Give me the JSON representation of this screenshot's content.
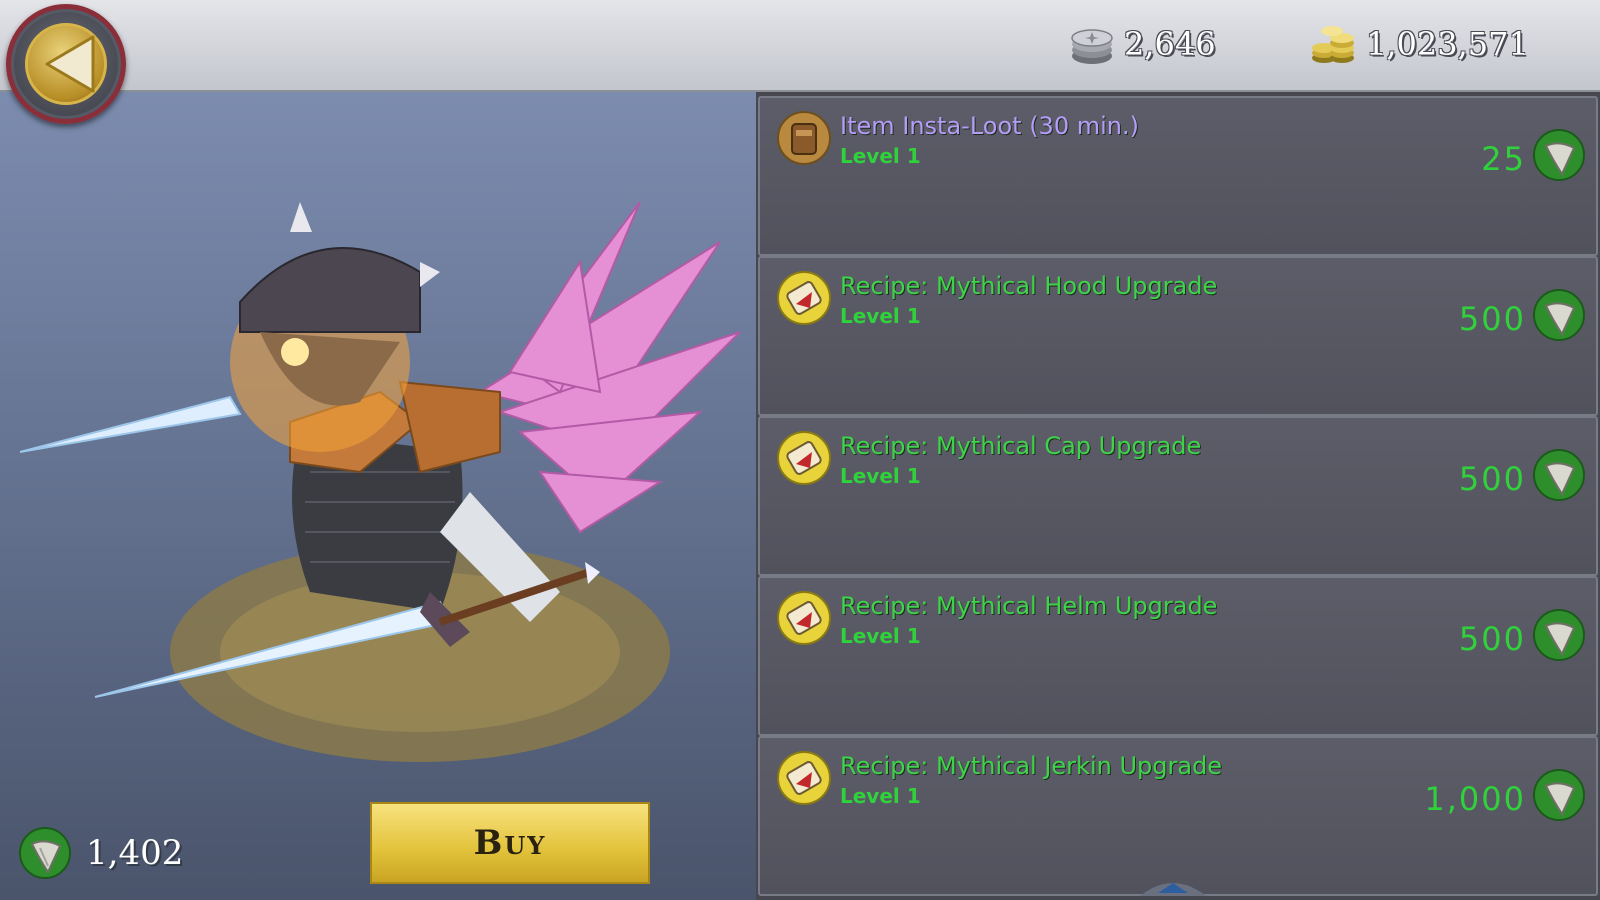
{
  "header": {
    "back_icon": "back-arrow-icon",
    "silver_value": "2,646",
    "silver_icon": "silver-coin-stack-icon",
    "gold_value": "1,023,571",
    "gold_icon": "gold-coin-stack-icon"
  },
  "preview": {
    "balance_value": "1,402",
    "balance_icon": "shark-tooth-icon",
    "buy_label": "Buy"
  },
  "items": [
    {
      "name": "Item Insta-Loot (30 min.)",
      "level": "Level 1",
      "price": "25",
      "icon": "loot-bag-icon",
      "name_color": "#b49cf7"
    },
    {
      "name": "Recipe: Mythical Hood Upgrade",
      "level": "Level 1",
      "price": "500",
      "icon": "recipe-scroll-icon",
      "name_color": "#3ed44a"
    },
    {
      "name": "Recipe: Mythical Cap Upgrade",
      "level": "Level 1",
      "price": "500",
      "icon": "recipe-scroll-icon",
      "name_color": "#3ed44a"
    },
    {
      "name": "Recipe: Mythical Helm Upgrade",
      "level": "Level 1",
      "price": "500",
      "icon": "recipe-scroll-icon",
      "name_color": "#3ed44a"
    },
    {
      "name": "Recipe: Mythical Jerkin Upgrade",
      "level": "Level 1",
      "price": "1,000",
      "icon": "recipe-scroll-icon",
      "name_color": "#3ed44a"
    }
  ],
  "colors": {
    "price_green": "#2fd23a",
    "panel_bg": "#52525d",
    "buy_gold": "#e2c23a"
  }
}
